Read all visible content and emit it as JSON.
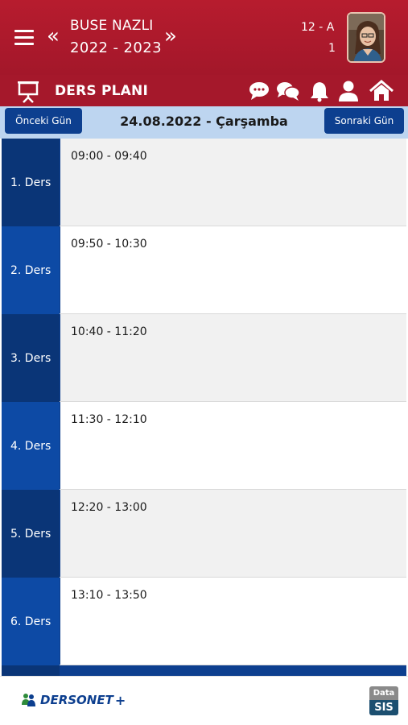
{
  "header": {
    "student_name": "BUSE NAZLI",
    "school_year": "2022 - 2023",
    "class_name": "12 - A",
    "class_no": "1"
  },
  "subheader": {
    "title": "DERS PLANI"
  },
  "datebar": {
    "prev_label": "Önceki Gün",
    "date": "24.08.2022 - Çarşamba",
    "next_label": "Sonraki Gün"
  },
  "lessons": [
    {
      "label": "1. Ders",
      "time": "09:00 - 09:40"
    },
    {
      "label": "2. Ders",
      "time": "09:50 - 10:30"
    },
    {
      "label": "3. Ders",
      "time": "10:40 - 11:20"
    },
    {
      "label": "4. Ders",
      "time": "11:30 - 12:10"
    },
    {
      "label": "5. Ders",
      "time": "12:20 - 13:00"
    },
    {
      "label": "6. Ders",
      "time": "13:10 - 13:50"
    }
  ],
  "footer": {
    "logo_text": "DERSONET",
    "logo_plus": "+",
    "datasis_top": "Data",
    "datasis_bottom": "SIS"
  },
  "icons": {
    "menu": "menu-icon",
    "prev_year": "double-chevron-left-icon",
    "next_year": "double-chevron-right-icon",
    "presentation": "presentation-board-icon",
    "message": "chat-bubble-icon",
    "messages": "chat-bubbles-icon",
    "notification": "bell-icon",
    "profile": "user-icon",
    "home": "home-icon"
  },
  "colors": {
    "header_red": "#b71c2e",
    "nav_blue": "#0d3f8f",
    "date_bar": "#bdd5f0"
  }
}
